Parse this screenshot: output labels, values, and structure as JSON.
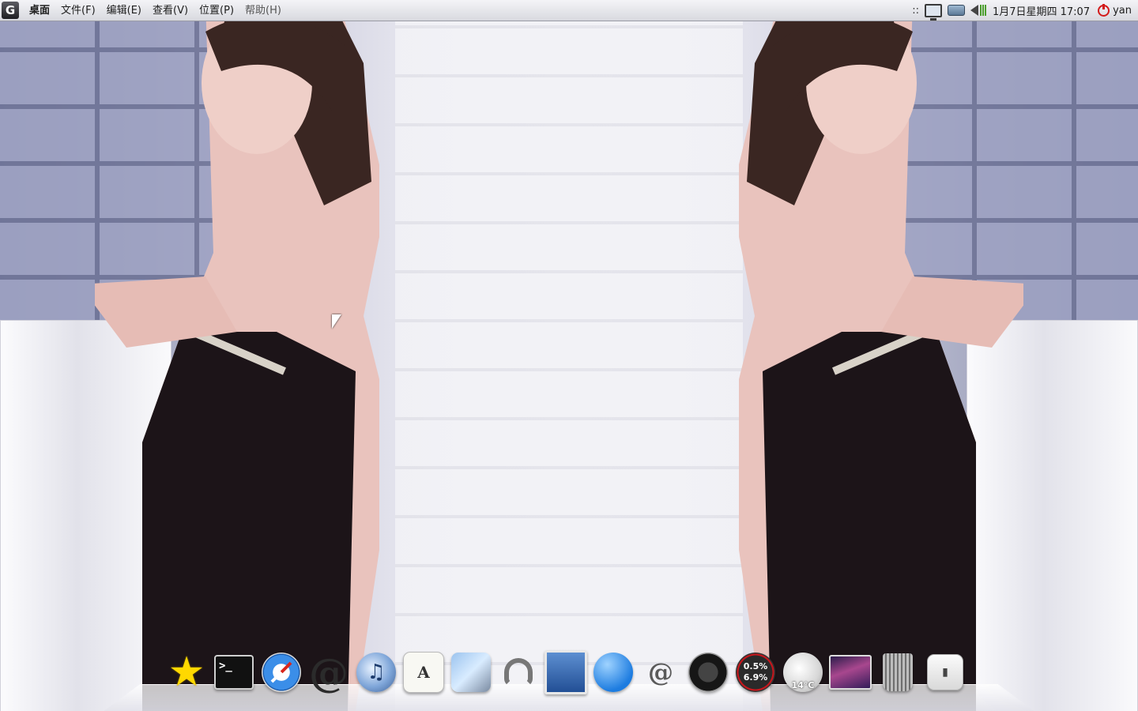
{
  "top_panel": {
    "app_icon_glyph": "G",
    "menus": [
      {
        "label": "桌面"
      },
      {
        "label": "文件(F)"
      },
      {
        "label": "编辑(E)"
      },
      {
        "label": "查看(V)"
      },
      {
        "label": "位置(P)"
      },
      {
        "label": "帮助(H)"
      }
    ],
    "tray": {
      "grip": "::",
      "clock": "1月7日星期四 17:07",
      "user": "yan"
    }
  },
  "dock": {
    "terminal_prompt": ">_",
    "atmail_glyph": "@",
    "itunes_glyph": "♫",
    "textedit_glyph": "A",
    "mailspring_glyph": "@",
    "star_glyph": "★",
    "sysmon": {
      "cpu": "0.5%",
      "mem": "6.9%"
    },
    "weather": {
      "temp": "14°C"
    },
    "switch_glyph": "▮"
  }
}
